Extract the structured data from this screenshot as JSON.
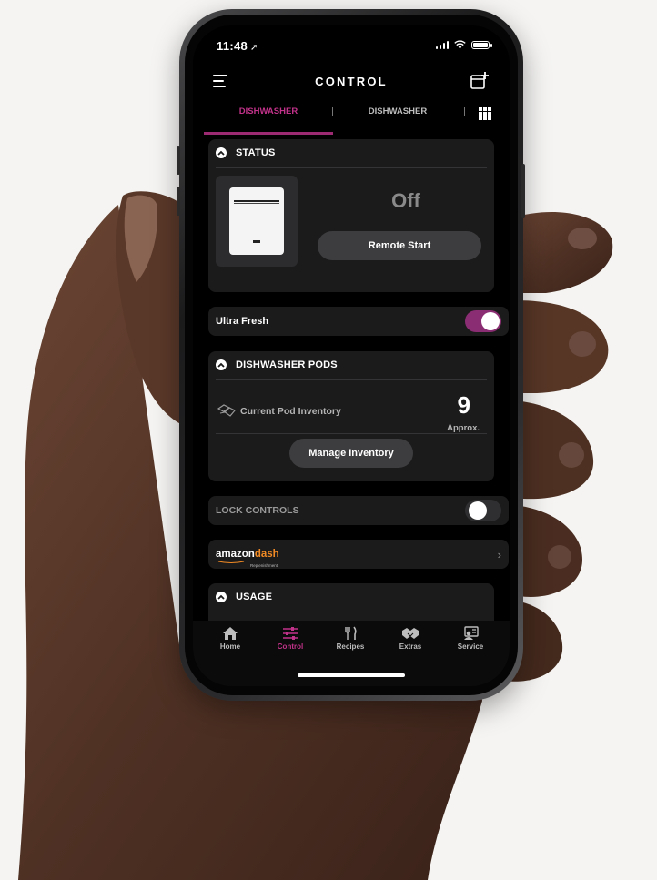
{
  "status_bar": {
    "time": "11:48"
  },
  "header": {
    "title": "CONTROL"
  },
  "tabs": [
    {
      "label": "DISHWASHER",
      "active": true
    },
    {
      "label": "DISHWASHER",
      "active": false
    }
  ],
  "status_card": {
    "title": "STATUS",
    "state": "Off",
    "remote_start_label": "Remote Start"
  },
  "ultra_fresh": {
    "label": "Ultra Fresh",
    "enabled": true
  },
  "pods_card": {
    "title": "DISHWASHER PODS",
    "inventory_label": "Current Pod Inventory",
    "count": "9",
    "approx_label": "Approx.",
    "manage_label": "Manage Inventory"
  },
  "lock_controls": {
    "label": "LOCK CONTROLS",
    "enabled": false
  },
  "amazon_dash": {
    "brand": "amazon",
    "product": "dash",
    "subtitle": "Replenishment"
  },
  "usage_card": {
    "title": "USAGE"
  },
  "bottom_nav": [
    {
      "label": "Home",
      "icon": "home-icon",
      "active": false
    },
    {
      "label": "Control",
      "icon": "sliders-icon",
      "active": true
    },
    {
      "label": "Recipes",
      "icon": "fork-knife-icon",
      "active": false
    },
    {
      "label": "Extras",
      "icon": "handshake-icon",
      "active": false
    },
    {
      "label": "Service",
      "icon": "service-person-icon",
      "active": false
    }
  ],
  "colors": {
    "accent": "#9b2a72",
    "accent_text": "#c2328a",
    "card_bg": "#1b1b1c",
    "screen_bg": "#000000",
    "page_bg": "#f5f4f2",
    "amazon_orange": "#f08a24"
  }
}
